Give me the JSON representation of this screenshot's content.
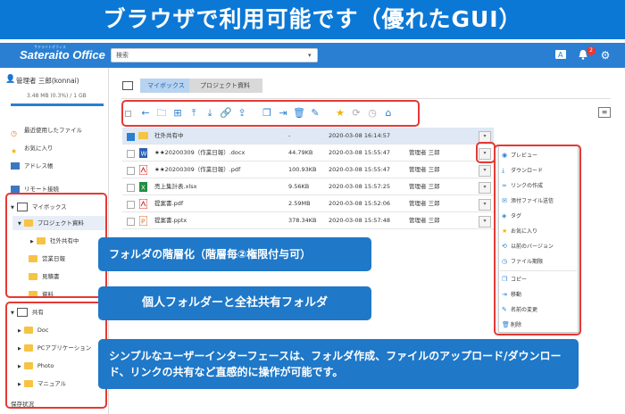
{
  "banner": {
    "title": "ブラウザで利用可能です（優れたGUI）"
  },
  "app": {
    "logo": "Sateraito Office",
    "logo_sub": "サテライトオフィス"
  },
  "search": {
    "placeholder": "検索"
  },
  "header": {
    "notification_count": "2"
  },
  "user": {
    "name": "管理者 三郎(konnai)",
    "storage": "3.48 MB (0.3%) / 1 GB"
  },
  "sidebar": {
    "items": [
      {
        "label": "最近使用したファイル"
      },
      {
        "label": "お気に入り"
      },
      {
        "label": "アドレス帳"
      },
      {
        "label": "リモート接続"
      },
      {
        "label": "マイボックス"
      },
      {
        "label": "プロジェクト資料"
      },
      {
        "label": "社外共有中"
      },
      {
        "label": "営業日報"
      },
      {
        "label": "見積書"
      },
      {
        "label": "資料"
      },
      {
        "label": "共有"
      },
      {
        "label": "Doc"
      },
      {
        "label": "PCアプリケーション"
      },
      {
        "label": "Photo"
      },
      {
        "label": "マニュアル"
      },
      {
        "label": "保存状況"
      }
    ]
  },
  "breadcrumb": {
    "items": [
      "マイボックス",
      "プロジェクト資料"
    ]
  },
  "files": [
    {
      "name": "社外共有中",
      "size": "-",
      "date": "2020-03-08 16:14:57",
      "owner": "",
      "type": "folder"
    },
    {
      "name": "★★20200309（作業日報）.docx",
      "size": "44.79KB",
      "date": "2020-03-08 15:55:47",
      "owner": "管理者 三郎",
      "type": "docx"
    },
    {
      "name": "★★20200309（作業日報）.pdf",
      "size": "100.93KB",
      "date": "2020-03-08 15:55:47",
      "owner": "管理者 三郎",
      "type": "pdf"
    },
    {
      "name": "売上集計表.xlsx",
      "size": "9.56KB",
      "date": "2020-03-08 15:57:25",
      "owner": "管理者 三郎",
      "type": "xlsx"
    },
    {
      "name": "提案書.pdf",
      "size": "2.59MB",
      "date": "2020-03-08 15:52:06",
      "owner": "管理者 三郎",
      "type": "pdf"
    },
    {
      "name": "提案書.pptx",
      "size": "378.34KB",
      "date": "2020-03-08 15:57:48",
      "owner": "管理者 三郎",
      "type": "pptx"
    }
  ],
  "context_menu": {
    "items": [
      {
        "label": "プレビュー",
        "icon": "eye-icon"
      },
      {
        "label": "ダウンロード",
        "icon": "download-icon"
      },
      {
        "label": "リンクの作成",
        "icon": "link-icon"
      },
      {
        "label": "添付ファイル送信",
        "icon": "mail-icon"
      },
      {
        "label": "タグ",
        "icon": "tag-icon"
      },
      {
        "label": "お気に入り",
        "icon": "star-icon"
      },
      {
        "label": "以前のバージョン",
        "icon": "history-icon"
      },
      {
        "label": "ファイル期限",
        "icon": "clock-icon"
      },
      {
        "label": "コピー",
        "icon": "copy-icon"
      },
      {
        "label": "移動",
        "icon": "move-icon"
      },
      {
        "label": "名前の変更",
        "icon": "rename-icon"
      },
      {
        "label": "削除",
        "icon": "trash-icon"
      }
    ]
  },
  "callouts": {
    "hierarchy": "フォルダの階層化（階層毎②権限付与可）",
    "personal": "個人フォルダーと全社共有フォルダ",
    "simple": "シンプルなユーザーインターフェースは、フォルダ作成、ファイルのアップロード/ダウンロード、リンクの共有など直感的に操作が可能です。"
  },
  "colors": {
    "banner": "#0b78d6",
    "appbar": "#2a7fd3",
    "callout": "#1f78c8",
    "highlight": "#e53935",
    "folder": "#f6c343"
  }
}
